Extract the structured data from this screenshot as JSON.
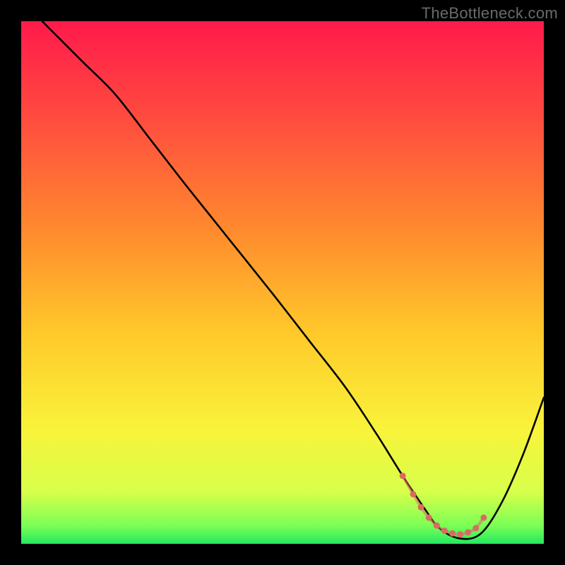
{
  "watermark": "TheBottleneck.com",
  "chart_data": {
    "type": "line",
    "title": "",
    "xlabel": "",
    "ylabel": "",
    "xlim": [
      0,
      100
    ],
    "ylim": [
      0,
      100
    ],
    "gradient_stops": [
      {
        "offset": 0,
        "color": "#ff1a4b"
      },
      {
        "offset": 0.18,
        "color": "#ff4a3f"
      },
      {
        "offset": 0.4,
        "color": "#ff8a2e"
      },
      {
        "offset": 0.6,
        "color": "#ffca2a"
      },
      {
        "offset": 0.78,
        "color": "#f9f33a"
      },
      {
        "offset": 0.9,
        "color": "#d8ff4a"
      },
      {
        "offset": 0.965,
        "color": "#7cff55"
      },
      {
        "offset": 1.0,
        "color": "#24e860"
      }
    ],
    "series": [
      {
        "name": "bottleneck-curve",
        "color": "#000000",
        "x": [
          4,
          8,
          12,
          18,
          25,
          32,
          40,
          48,
          55,
          62,
          68,
          73,
          77,
          80,
          84,
          88,
          92,
          96,
          100
        ],
        "y": [
          100,
          96,
          92,
          86,
          77,
          68,
          58,
          48,
          39,
          30,
          21,
          13,
          7,
          3,
          1,
          2,
          8,
          17,
          28
        ]
      }
    ],
    "markers": {
      "name": "optimal-range",
      "color": "#d86b63",
      "radius": 4.5,
      "x": [
        73,
        75,
        76.5,
        78,
        79.5,
        81,
        82.5,
        84,
        85.5,
        87,
        88.5
      ],
      "y": [
        13,
        9.5,
        7,
        5,
        3.5,
        2.5,
        2,
        1.8,
        2.2,
        3,
        5
      ]
    }
  }
}
